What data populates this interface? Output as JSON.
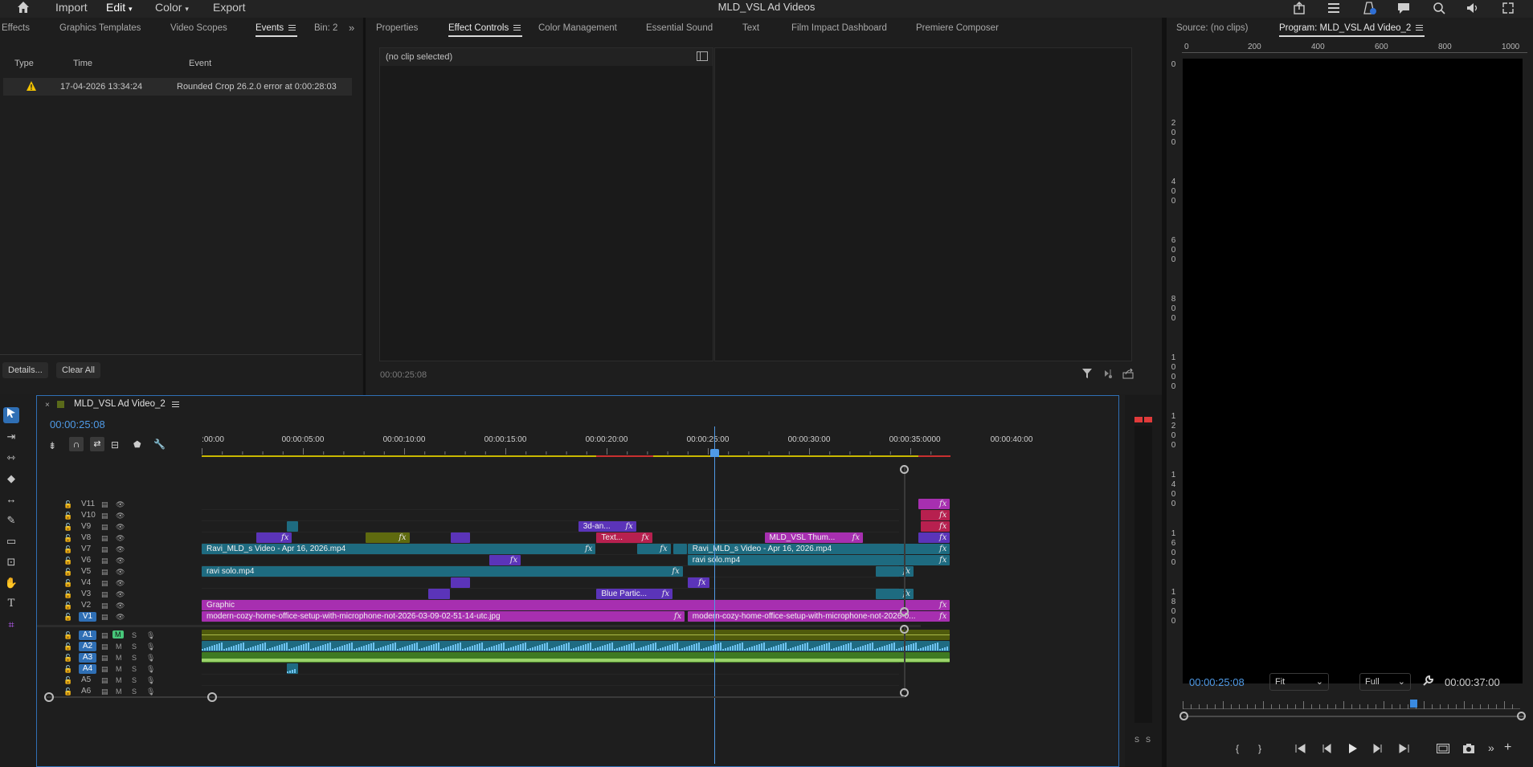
{
  "app": {
    "title": "MLD_VSL Ad Videos",
    "menu": [
      "Import",
      "Edit",
      "Color",
      "Export"
    ],
    "active_menu": "Edit"
  },
  "left_panel": {
    "tabs": [
      "Effects",
      "Graphics Templates",
      "Video Scopes",
      "Events",
      "Bin: 2"
    ],
    "active_tab": "Events",
    "columns": [
      "Type",
      "Time",
      "Event"
    ],
    "rows": [
      {
        "type_icon": "warning-icon",
        "time": "17-04-2026 13:34:24",
        "event": "Rounded Crop 26.2.0 error at 0:00:28:03"
      }
    ],
    "buttons": [
      "Details...",
      "Clear All"
    ]
  },
  "center_panel": {
    "tabs": [
      "Properties",
      "Effect Controls",
      "Color Management",
      "Essential Sound",
      "Text",
      "Film Impact Dashboard",
      "Premiere Composer"
    ],
    "active_tab": "Effect Controls",
    "no_clip": "(no clip selected)",
    "timecode": "00:00:25:08"
  },
  "right_panel": {
    "tabs": [
      "Source: (no clips)",
      "Program: MLD_VSL Ad Video_2"
    ],
    "active_tab": "Program: MLD_VSL Ad Video_2",
    "ruler_labels": [
      "0",
      "200",
      "400",
      "600",
      "800",
      "1000"
    ],
    "vruler_labels": [
      "0",
      "200",
      "400",
      "600",
      "800",
      "1000",
      "1200",
      "1400",
      "1600",
      "1800"
    ],
    "timecode": "00:00:25:08",
    "fit": "Fit",
    "quality": "Full",
    "duration": "00:00:37:00",
    "playhead_fraction": 0.684
  },
  "timeline": {
    "sequence_name": "MLD_VSL Ad Video_2",
    "timecode": "00:00:25:08",
    "ruler_labels": [
      ":00:00",
      "00:00:05:00",
      "00:00:10:00",
      "00:00:15:00",
      "00:00:20:00",
      "00:00:25:00",
      "00:00:30:00",
      "00:00:35:00",
      "00:00:40:00",
      "00"
    ],
    "playhead_seconds": 25.33,
    "video_tracks": [
      "V11",
      "V10",
      "V9",
      "V8",
      "V7",
      "V6",
      "V5",
      "V4",
      "V3",
      "V2",
      "V1"
    ],
    "audio_tracks": [
      "A1",
      "A2",
      "A3",
      "A4",
      "A5",
      "A6"
    ],
    "audio_mute_labels": [
      "M",
      "M",
      "M",
      "M",
      "M",
      "M"
    ],
    "audio_solo_labels": [
      "S",
      "S",
      "S",
      "S",
      "S",
      "S"
    ],
    "clips": [
      {
        "track": "V11",
        "start": 35.4,
        "end": 37.0,
        "label": "",
        "color": "#a72fb0",
        "fx": "fx"
      },
      {
        "track": "V10",
        "start": 35.5,
        "end": 37.0,
        "label": "",
        "color": "#b7204f",
        "fx": "fx"
      },
      {
        "track": "V9",
        "start": 4.2,
        "end": 4.8,
        "label": "",
        "color": "#1e6b80",
        "fx": ""
      },
      {
        "track": "V9",
        "start": 18.6,
        "end": 21.5,
        "label": "3d-an...",
        "color": "#5b34b9",
        "fx": "fx"
      },
      {
        "track": "V9",
        "start": 35.5,
        "end": 37.0,
        "label": "",
        "color": "#b7204f",
        "fx": "fx"
      },
      {
        "track": "V8",
        "start": 2.7,
        "end": 4.5,
        "label": "",
        "color": "#5b34b9",
        "fx": "fx"
      },
      {
        "track": "V8",
        "start": 8.1,
        "end": 10.3,
        "label": "",
        "color": "#5f6a0f",
        "fx": "fx"
      },
      {
        "track": "V8",
        "start": 12.3,
        "end": 13.3,
        "label": "",
        "color": "#5b34b9",
        "fx": ""
      },
      {
        "track": "V8",
        "start": 19.5,
        "end": 22.3,
        "label": "Text...",
        "color": "#b7204f",
        "fx": "fx"
      },
      {
        "track": "V8",
        "start": 27.8,
        "end": 32.7,
        "label": "MLD_VSL Thum...",
        "color": "#a72fb0",
        "fx": "fx"
      },
      {
        "track": "V8",
        "start": 35.4,
        "end": 37.0,
        "label": "",
        "color": "#5b34b9",
        "fx": "fx"
      },
      {
        "track": "V7",
        "start": 0,
        "end": 19.5,
        "label": "Ravi_MLD_s Video - Apr 16, 2026.mp4",
        "color": "#1e6b80",
        "fx": "fx"
      },
      {
        "track": "V7",
        "start": 21.5,
        "end": 23.2,
        "label": "",
        "color": "#1e6b80",
        "fx": "fx"
      },
      {
        "track": "V7",
        "start": 23.3,
        "end": 24.0,
        "label": "",
        "color": "#1e6b80",
        "fx": ""
      },
      {
        "track": "V7",
        "start": 24.0,
        "end": 37.0,
        "label": "Ravi_MLD_s Video - Apr 16, 2026.mp4",
        "color": "#1e6b80",
        "fx": "fx"
      },
      {
        "track": "V6",
        "start": 14.2,
        "end": 15.8,
        "label": "",
        "color": "#5b34b9",
        "fx": "fx"
      },
      {
        "track": "V6",
        "start": 24.0,
        "end": 37.0,
        "label": "ravi solo.mp4",
        "color": "#1e6b80",
        "fx": "fx"
      },
      {
        "track": "V5",
        "start": 0,
        "end": 23.8,
        "label": "ravi solo.mp4",
        "color": "#1e6b80",
        "fx": "fx"
      },
      {
        "track": "V5",
        "start": 33.3,
        "end": 35.2,
        "label": "",
        "color": "#1e6b80",
        "fx": "fx"
      },
      {
        "track": "V4",
        "start": 12.3,
        "end": 13.3,
        "label": "",
        "color": "#5b34b9",
        "fx": ""
      },
      {
        "track": "V4",
        "start": 24.0,
        "end": 25.1,
        "label": "",
        "color": "#5b34b9",
        "fx": "fx"
      },
      {
        "track": "V3",
        "start": 11.2,
        "end": 12.3,
        "label": "",
        "color": "#5b34b9",
        "fx": ""
      },
      {
        "track": "V3",
        "start": 19.5,
        "end": 23.3,
        "label": "Blue Partic...",
        "color": "#5b34b9",
        "fx": "fx"
      },
      {
        "track": "V3",
        "start": 33.3,
        "end": 35.2,
        "label": "",
        "color": "#1e6b80",
        "fx": "fx"
      },
      {
        "track": "V2",
        "start": 0,
        "end": 37.0,
        "label": "Graphic",
        "color": "#a72fb0",
        "fx": "fx"
      },
      {
        "track": "V1",
        "start": 0,
        "end": 23.9,
        "label": "modern-cozy-home-office-setup-with-microphone-not-2026-03-09-02-51-14-utc.jpg",
        "color": "#a72fb0",
        "fx": "fx"
      },
      {
        "track": "V1",
        "start": 24.0,
        "end": 37.0,
        "label": "modern-cozy-home-office-setup-with-microphone-not-2026-0...",
        "color": "#a72fb0",
        "fx": "fx"
      }
    ],
    "audio_clips": [
      {
        "track": "A1",
        "start": 0,
        "end": 37.0,
        "color": "#4f5a0c"
      },
      {
        "track": "A2",
        "start": 0,
        "end": 37.0,
        "color": "#1f6b82"
      },
      {
        "track": "A3",
        "start": 0,
        "end": 37.0,
        "color": "#3f7a22"
      },
      {
        "track": "A4",
        "start": 4.2,
        "end": 4.8,
        "color": "#1f6b82"
      }
    ]
  },
  "meters": {
    "solo_labels": [
      "S",
      "S"
    ]
  },
  "colors": {
    "accent": "#2f6fb5",
    "timecode": "#4f9ae6",
    "playhead": "#4f9ae6"
  }
}
